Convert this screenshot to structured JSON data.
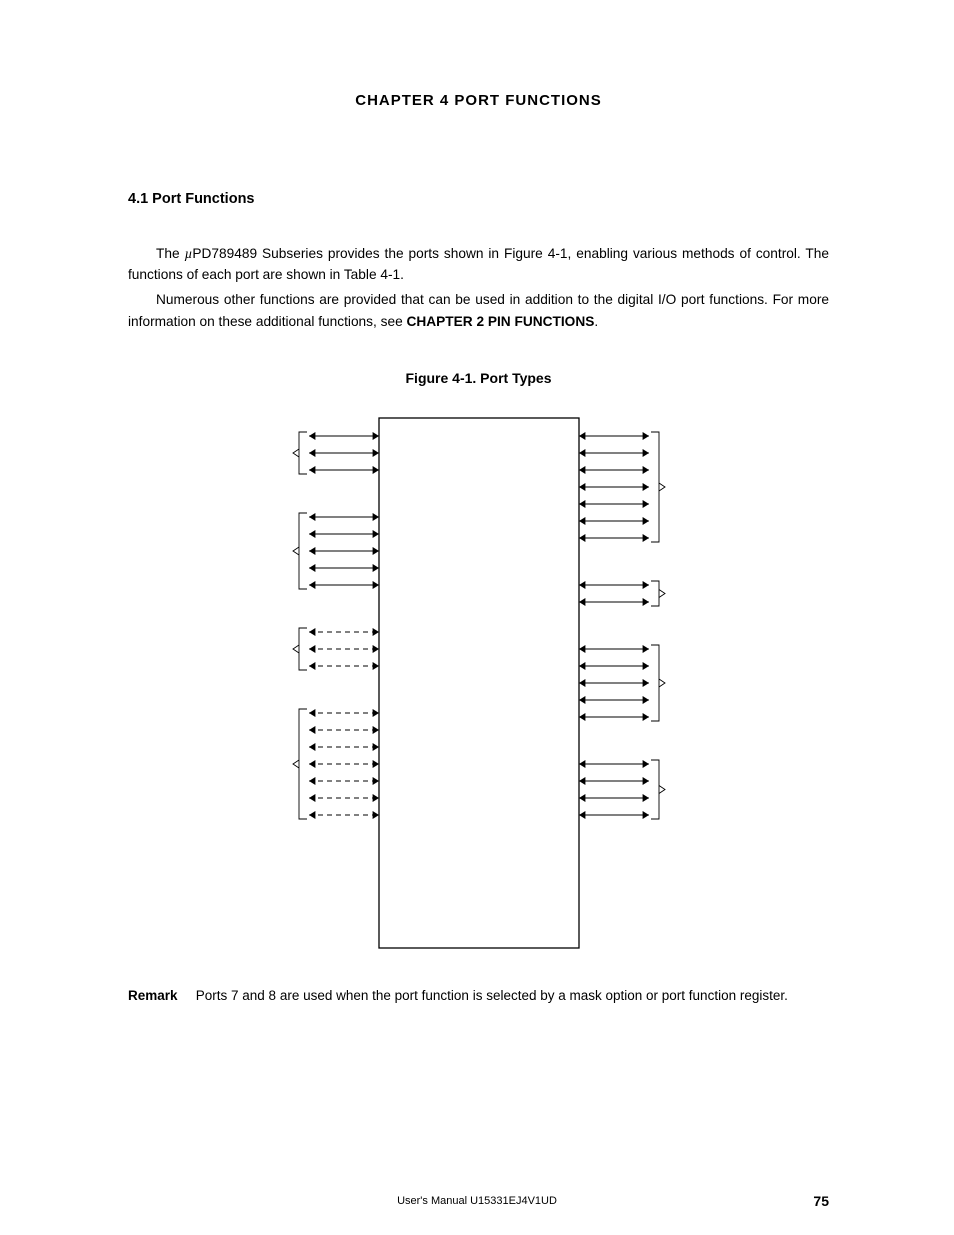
{
  "chapter_title": "CHAPTER  4   PORT  FUNCTIONS",
  "section_head": "4.1  Port Functions",
  "p1a": "The ",
  "p1_mu": "µ",
  "p1b": "PD789489 Subseries provides the ports shown in Figure 4-1, enabling various methods of control.  The functions of each port are shown in Table 4-1.",
  "p2a": "Numerous other functions are provided that can be used in addition to the digital I/O port functions.  For more information on these additional functions, see ",
  "p2b": "CHAPTER 2 PIN FUNCTIONS",
  "p2c": ".",
  "fig_caption": "Figure 4-1.  Port Types",
  "remark_label": "Remark",
  "remark_text": "Ports 7 and 8 are used when the port function is selected by a mask option or port function register.",
  "footer_center": "User's Manual  U15331EJ4V1UD",
  "page_number": "75",
  "fig": {
    "left_groups": [
      {
        "lines": 3,
        "dashed": false
      },
      {
        "lines": 5,
        "dashed": false
      },
      {
        "lines": 3,
        "dashed": true
      },
      {
        "lines": 7,
        "dashed": true
      }
    ],
    "right_groups": [
      {
        "lines": 7,
        "dashed": false
      },
      {
        "lines": 2,
        "dashed": false
      },
      {
        "lines": 5,
        "dashed": false
      },
      {
        "lines": 4,
        "dashed": false
      }
    ]
  }
}
